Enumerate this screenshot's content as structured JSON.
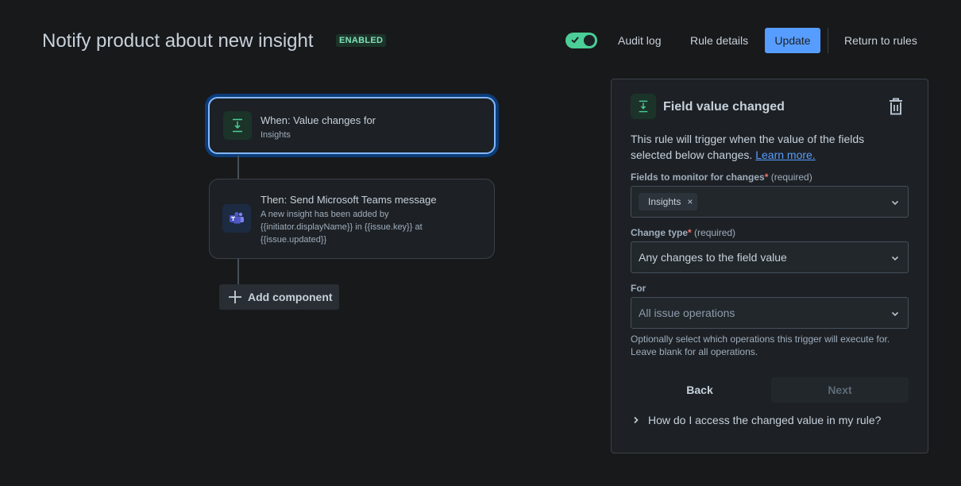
{
  "header": {
    "title": "Notify product about new insight",
    "status_badge": "ENABLED",
    "toggle_enabled": true,
    "audit_log": "Audit log",
    "rule_details": "Rule details",
    "update": "Update",
    "return_to_rules": "Return to rules"
  },
  "flow": {
    "trigger": {
      "title": "When: Value changes for",
      "subtitle": "Insights",
      "icon": "field-trigger-icon"
    },
    "action": {
      "title": "Then: Send Microsoft Teams message",
      "body_line1": "A new insight has been added by",
      "body_line2": "{{initiator.displayName}} in {{issue.key}} at",
      "body_line3": "{{issue.updated}}",
      "icon": "microsoft-teams-icon"
    },
    "add_component": "Add component"
  },
  "panel": {
    "title": "Field value changed",
    "description": "This rule will trigger when the value of the fields selected below changes.",
    "learn_more": "Learn more.",
    "fields_label": "Fields to monitor for changes",
    "fields_required": "(required)",
    "fields_chip": "Insights",
    "change_type_label": "Change type",
    "change_type_required": "(required)",
    "change_type_value": "Any changes to the field value",
    "for_label": "For",
    "for_placeholder": "All issue operations",
    "hint": "Optionally select which operations this trigger will execute for. Leave blank for all operations.",
    "back": "Back",
    "next": "Next",
    "faq": "How do I access the changed value in my rule?"
  },
  "colors": {
    "accent": "#579dff",
    "success": "#4bce97",
    "background": "#18191b",
    "surface": "#1d2125"
  }
}
